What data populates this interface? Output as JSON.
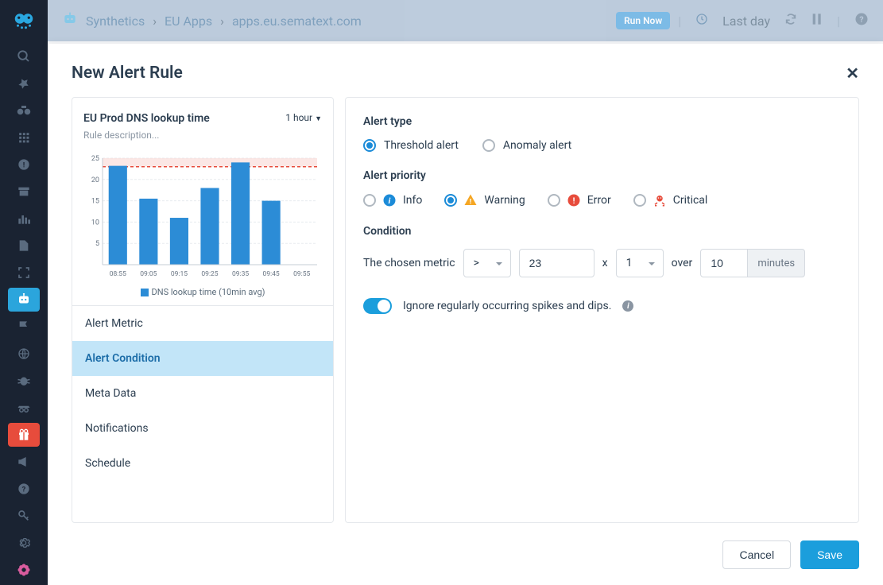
{
  "header": {
    "breadcrumbs": [
      "Synthetics",
      "EU Apps",
      "apps.eu.sematext.com"
    ],
    "run_label": "Run Now",
    "time_label": "Last day"
  },
  "modal": {
    "title": "New Alert Rule"
  },
  "chart": {
    "title": "EU Prod DNS lookup time",
    "time_range": "1 hour",
    "desc_placeholder": "Rule description...",
    "legend": "DNS lookup time (10min avg)"
  },
  "chart_data": {
    "type": "bar",
    "categories": [
      "08:55",
      "09:05",
      "09:15",
      "09:25",
      "09:35",
      "09:45",
      "09:55"
    ],
    "values": [
      23.2,
      15.5,
      11,
      18,
      24,
      15,
      null
    ],
    "ylim": [
      0,
      25
    ],
    "threshold": 23,
    "yticks": [
      5,
      10,
      15,
      20,
      25
    ],
    "ylabel": "",
    "xlabel": ""
  },
  "nav": {
    "items": [
      "Alert Metric",
      "Alert Condition",
      "Meta Data",
      "Notifications",
      "Schedule"
    ],
    "active": 1
  },
  "form": {
    "alert_type_label": "Alert type",
    "threshold_label": "Threshold alert",
    "anomaly_label": "Anomaly alert",
    "priority_label": "Alert priority",
    "priorities": {
      "info": "Info",
      "warning": "Warning",
      "error": "Error",
      "critical": "Critical"
    },
    "condition_label": "Condition",
    "condition_text": "The chosen metric",
    "operator": ">",
    "threshold_value": "23",
    "x_label": "x",
    "multiplier": "1",
    "over_label": "over",
    "duration": "10",
    "duration_unit": "minutes",
    "ignore_label": "Ignore regularly occurring spikes and dips."
  },
  "footer": {
    "cancel": "Cancel",
    "save": "Save"
  }
}
